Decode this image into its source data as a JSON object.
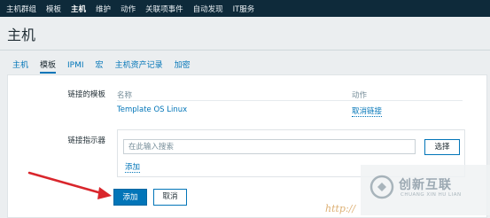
{
  "topnav": {
    "items": [
      "主机群组",
      "模板",
      "主机",
      "维护",
      "动作",
      "关联项事件",
      "自动发现",
      "IT服务"
    ],
    "active_index": 2
  },
  "page": {
    "title": "主机"
  },
  "tabs": {
    "items": [
      "主机",
      "模板",
      "IPMI",
      "宏",
      "主机资产记录",
      "加密"
    ],
    "active_index": 1
  },
  "linked_templates": {
    "label": "链接的模板",
    "col_name": "名称",
    "col_action": "动作",
    "rows": [
      {
        "name": "Template OS Linux",
        "action": "取消链接"
      }
    ]
  },
  "link_indicator": {
    "label": "链接指示器",
    "search_placeholder": "在此输入搜索",
    "select_label": "选择",
    "add_label": "添加"
  },
  "form_buttons": {
    "add_label": "添加",
    "cancel_label": "取消"
  },
  "watermark": {
    "cn": "创新互联",
    "en": "CHUANG XIN HU LIAN",
    "url": "http://"
  },
  "colors": {
    "accent": "#0275b8",
    "topnav_bg": "#0e2a3a",
    "arrow": "#d9262c"
  }
}
